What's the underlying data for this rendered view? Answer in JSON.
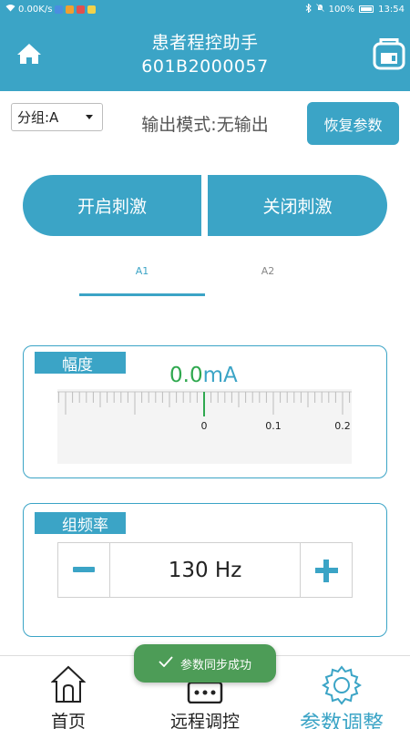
{
  "status_bar": {
    "network_speed": "0.00K/s",
    "battery": "100%",
    "time": "13:54"
  },
  "header": {
    "title": "患者程控助手",
    "device_id": "601B2000057"
  },
  "controls": {
    "group_select": "分组:A",
    "output_mode": "输出模式:无输出",
    "restore_button": "恢复参数"
  },
  "stimulation": {
    "on_label": "开启刺激",
    "off_label": "关闭刺激"
  },
  "tabs": [
    {
      "label": "A1",
      "active": true
    },
    {
      "label": "A2",
      "active": false
    }
  ],
  "amplitude": {
    "label": "幅度",
    "value": "0.0",
    "unit": "mA",
    "scale_ticks": [
      "0",
      "0.1",
      "0.2"
    ],
    "current_level": 0
  },
  "frequency": {
    "label": "组频率",
    "value": "130 Hz"
  },
  "toast": {
    "message": "参数同步成功"
  },
  "bottom_nav": [
    {
      "label": "首页",
      "icon": "house-icon"
    },
    {
      "label": "远程调控",
      "icon": "chat-bubble-icon"
    },
    {
      "label": "参数调整",
      "icon": "gear-icon",
      "active": true
    }
  ],
  "colors": {
    "primary": "#3ba4c6",
    "value_green": "#2fa84f",
    "toast_green": "#4d9c57"
  }
}
